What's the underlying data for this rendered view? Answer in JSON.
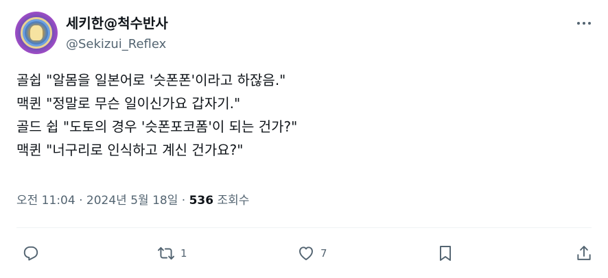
{
  "user": {
    "display_name": "세키한@척수반사",
    "handle": "@Sekizui_Reflex"
  },
  "tweet": {
    "lines": [
      "골쉽 \"알몸을 일본어로 '슷폰폰'이라고 하잖음.\"",
      "맥퀸 \"정말로 무슨 일이신가요 갑자기.\"",
      "골드 쉽 \"도토의 경우 '슷폰포코폼'이 되는 건가?\"",
      "맥퀸 \"너구리로 인식하고 계신 건가요?\""
    ]
  },
  "meta": {
    "time": "오전 11:04",
    "sep1": "·",
    "date": "2024년 5월 18일",
    "sep2": "·",
    "views": "536",
    "views_label": "조회수"
  },
  "actions": {
    "retweets": "1",
    "likes": "7"
  },
  "icons": [
    "avatar",
    "more-icon",
    "reply-icon",
    "retweet-icon",
    "like-icon",
    "bookmark-icon",
    "share-icon"
  ]
}
